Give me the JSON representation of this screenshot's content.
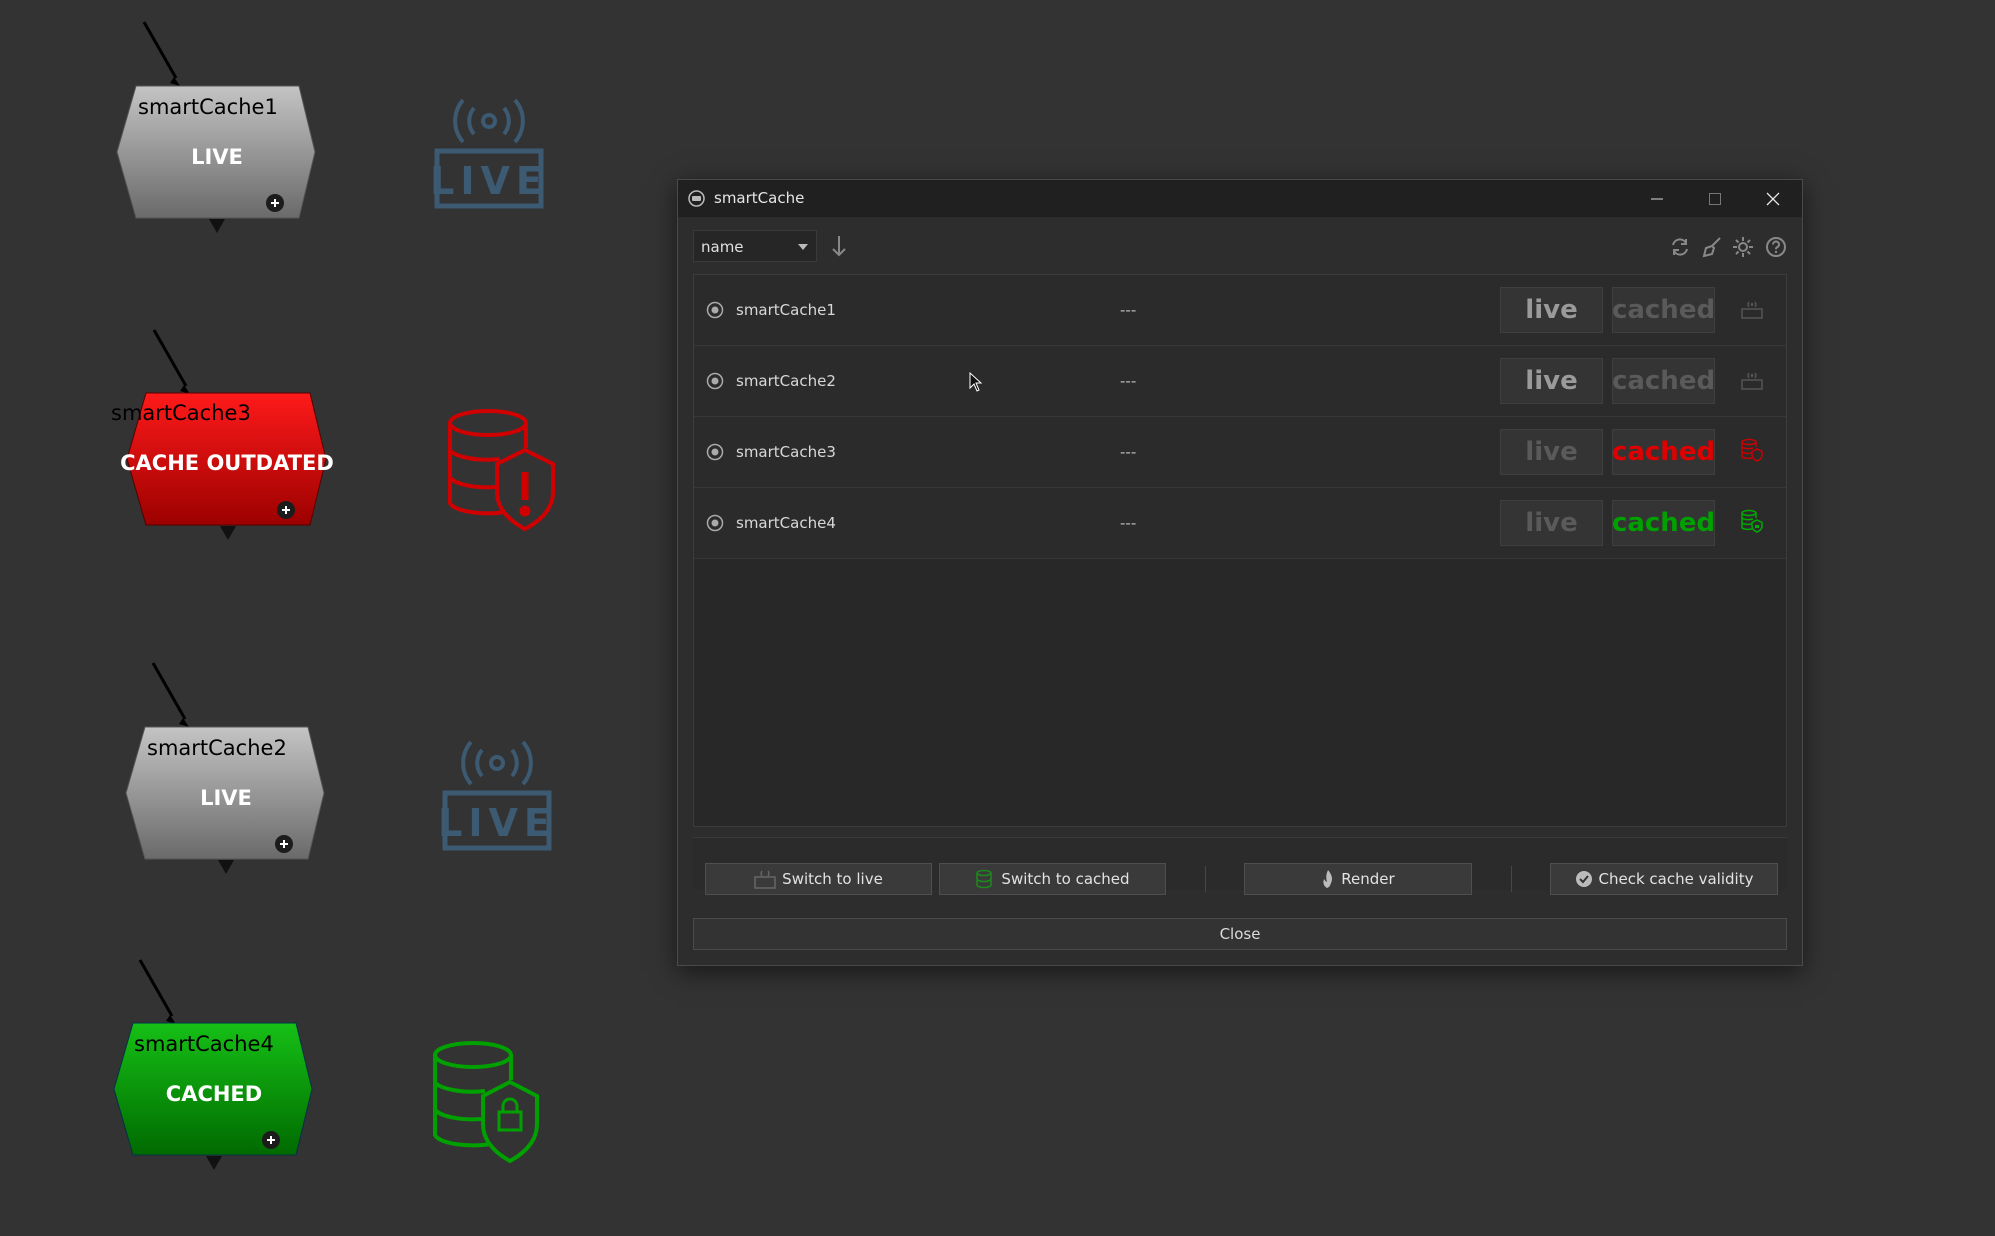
{
  "graph": {
    "nodes": [
      {
        "name": "smartCache1",
        "status": "LIVE",
        "state": "live"
      },
      {
        "name": "smartCache3",
        "status": "CACHE OUTDATED",
        "state": "outdated"
      },
      {
        "name": "smartCache2",
        "status": "LIVE",
        "state": "live"
      },
      {
        "name": "smartCache4",
        "status": "CACHED",
        "state": "cached"
      }
    ],
    "badge_live_text": "LIVE"
  },
  "window": {
    "title": "smartCache"
  },
  "toolbar": {
    "sort_value": "name"
  },
  "list": {
    "rows": [
      {
        "name": "smartCache1",
        "info": "---",
        "live_label": "live",
        "cached_label": "cached",
        "state": "live"
      },
      {
        "name": "smartCache2",
        "info": "---",
        "live_label": "live",
        "cached_label": "cached",
        "state": "live"
      },
      {
        "name": "smartCache3",
        "info": "---",
        "live_label": "live",
        "cached_label": "cached",
        "state": "outdated"
      },
      {
        "name": "smartCache4",
        "info": "---",
        "live_label": "live",
        "cached_label": "cached",
        "state": "cached"
      }
    ]
  },
  "actions": {
    "switch_live": "Switch to live",
    "switch_cached": "Switch to cached",
    "render": "Render",
    "check_validity": "Check cache validity",
    "close": "Close"
  },
  "colors": {
    "background": "#333333",
    "live_gray": "#9a9a9a",
    "outdated_red": "#e00000",
    "cached_green": "#00a000",
    "badge_blue": "#3d5a73",
    "dim_text": "#5a5a5a"
  }
}
